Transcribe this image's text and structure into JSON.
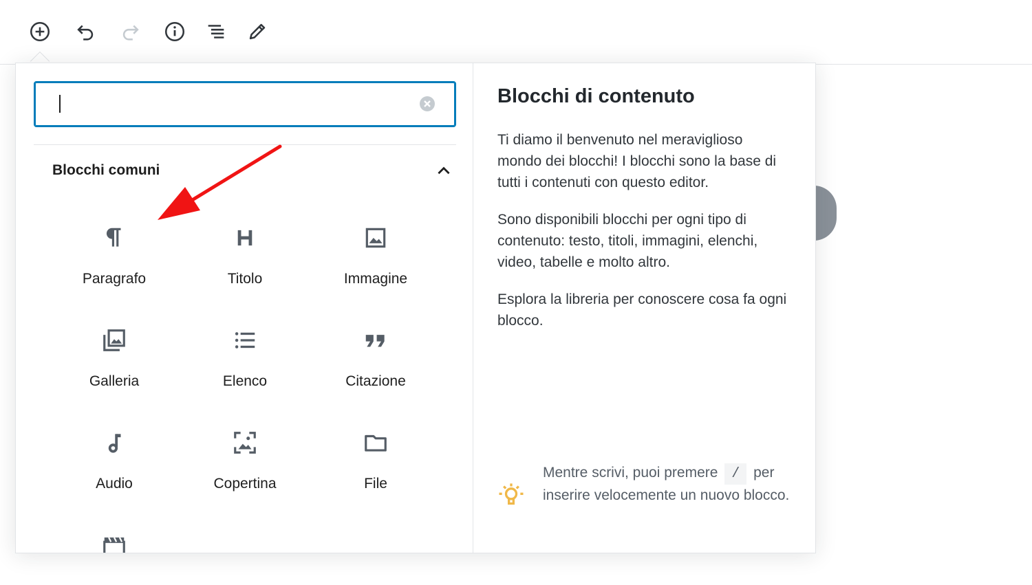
{
  "colors": {
    "accent": "#007cba",
    "icon": "#555d66",
    "icon_disabled": "#c5cbd0",
    "annotation": "#f01414",
    "tip": "#f0b849"
  },
  "toolbar": {
    "items": [
      {
        "name": "add-block",
        "icon": "plus-circle-icon",
        "disabled": false
      },
      {
        "name": "undo",
        "icon": "undo-icon",
        "disabled": false
      },
      {
        "name": "redo",
        "icon": "redo-icon",
        "disabled": true
      },
      {
        "name": "info",
        "icon": "info-icon",
        "disabled": false
      },
      {
        "name": "outline",
        "icon": "list-outline-icon",
        "disabled": false
      },
      {
        "name": "tools",
        "icon": "pencil-icon",
        "disabled": false
      }
    ]
  },
  "inserter": {
    "search": {
      "value": "",
      "placeholder": ""
    },
    "section": {
      "title": "Blocchi comuni",
      "expanded": true
    },
    "blocks": [
      {
        "label": "Paragrafo",
        "icon": "paragraph-icon"
      },
      {
        "label": "Titolo",
        "icon": "heading-icon"
      },
      {
        "label": "Immagine",
        "icon": "image-icon"
      },
      {
        "label": "Galleria",
        "icon": "gallery-icon"
      },
      {
        "label": "Elenco",
        "icon": "list-icon"
      },
      {
        "label": "Citazione",
        "icon": "quote-icon"
      },
      {
        "label": "Audio",
        "icon": "audio-icon"
      },
      {
        "label": "Copertina",
        "icon": "cover-icon"
      },
      {
        "label": "File",
        "icon": "folder-icon"
      },
      {
        "label": "",
        "icon": "video-icon"
      }
    ]
  },
  "help_panel": {
    "title": "Blocchi di contenuto",
    "paragraphs": [
      "Ti diamo il benvenuto nel meraviglioso mondo dei blocchi! I blocchi sono la base di tutti i contenuti con questo editor.",
      "Sono disponibili blocchi per ogni tipo di contenuto: testo, titoli, immagini, elenchi, video, tabelle e molto altro.",
      "Esplora la libreria per conoscere cosa fa ogni blocco."
    ],
    "tip": {
      "before": "Mentre scrivi, puoi premere",
      "key": "/",
      "after": "per inserire velocemente un nuovo blocco.",
      "icon": "lightbulb-icon"
    }
  }
}
